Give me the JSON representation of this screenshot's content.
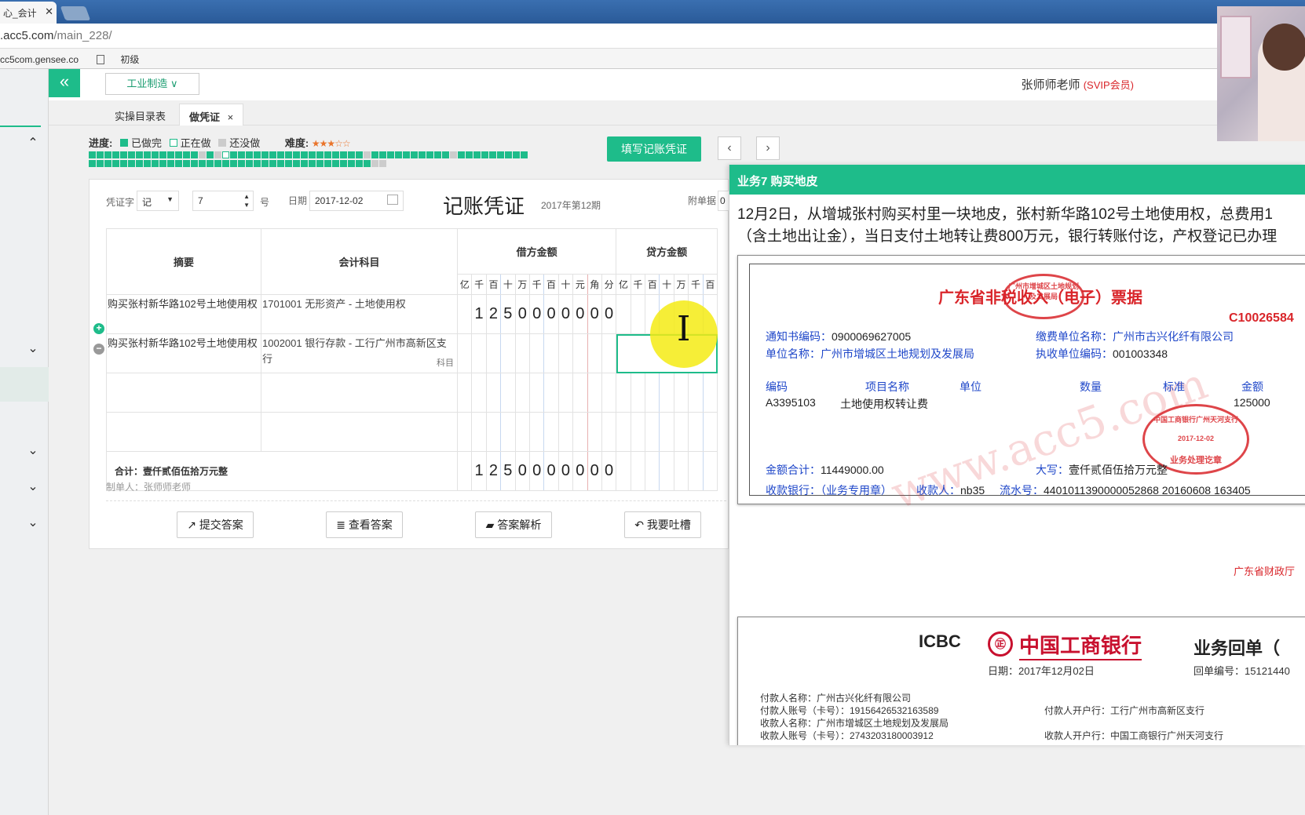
{
  "browser": {
    "tab_title": "心_会计",
    "url_host": ".acc5.com",
    "url_path": "/main_228/",
    "bookmarks": [
      "cc5com.gensee.co",
      "初级"
    ]
  },
  "header": {
    "industry": "工业制造 ∨",
    "user_name": "张师师老师",
    "user_vip": "(SVIP会员)"
  },
  "subtabs": [
    "实操目录表",
    "做凭证"
  ],
  "progress": {
    "label": "进度:",
    "done": "已做完",
    "doing": "正在做",
    "todo": "还没做",
    "difficulty_label": "难度:",
    "difficulty_stars": "★★★☆☆"
  },
  "actions": {
    "fill_voucher": "填写记账凭证",
    "prev": "‹",
    "next": "›"
  },
  "voucher": {
    "word_label": "凭证字",
    "word_value": "记",
    "number": "7",
    "number_suffix": "号",
    "date_label": "日期",
    "date_value": "2017-12-02",
    "title": "记账凭证",
    "period": "2017年第12期",
    "attach_label": "附单据",
    "attach_value": "0",
    "headers": {
      "summary": "摘要",
      "account": "会计科目",
      "debit": "借方金额",
      "credit": "贷方金额"
    },
    "digit_units": [
      "亿",
      "千",
      "百",
      "十",
      "万",
      "千",
      "百",
      "十",
      "元",
      "角",
      "分"
    ],
    "rows": [
      {
        "summary": "购买张村新华路102号土地使用权",
        "account": "1701001 无形资产 - 土地使用权",
        "debit_digits": [
          "",
          "1",
          "2",
          "5",
          "0",
          "0",
          "0",
          "0",
          "0",
          "0",
          "0"
        ]
      },
      {
        "summary": "购买张村新华路102号土地使用权",
        "account": "1002001 银行存款 - 工行广州市高新区支行",
        "account_tag": "科目",
        "debit_digits": [
          "",
          "",
          "",
          "",
          "",
          "",
          "",
          "",
          "",
          "",
          ""
        ]
      }
    ],
    "total_label": "合计：壹仟贰佰伍拾万元整",
    "total_digits": [
      "",
      "1",
      "2",
      "5",
      "0",
      "0",
      "0",
      "0",
      "0",
      "0",
      "0"
    ],
    "maker": "制单人：张师师老师",
    "buttons": {
      "submit": "提交答案",
      "view": "查看答案",
      "analysis": "答案解析",
      "complain": "我要吐槽"
    }
  },
  "panel": {
    "title": "业务7 购买地皮",
    "desc_line1": "12月2日，从增城张村购买村里一块地皮，张村新华路102号土地使用权，总费用1",
    "desc_line2": "（含土地出让金），当日支付土地转让费800万元，银行转账付讫，产权登记已办理",
    "receipt1": {
      "title": "广东省非税收入（电子）票据",
      "code": "C10026584",
      "notice_label": "通知书编码：",
      "notice_value": "0900069627005",
      "payer_label": "缴费单位名称：",
      "payer_value": "广州市古兴化纤有限公司",
      "unit_label": "单位名称：",
      "unit_value": "广州市增城区土地规划及发展局",
      "exec_label": "执收单位编码：",
      "exec_value": "001003348",
      "col_code": "编码",
      "col_item": "项目名称",
      "col_unit": "单位",
      "col_qty": "数量",
      "col_std": "标准",
      "col_amt": "金额",
      "item_code": "A3395103",
      "item_name": "土地使用权转让费",
      "item_amt": "125000",
      "sum_label": "金额合计：",
      "sum_value": "11449000.00",
      "cap_label": "大写：",
      "cap_value": "壹仟贰佰伍拾万元整",
      "bank_label": "收款银行：（业务专用章）",
      "payee_label": "收款人：",
      "payee_value": "nb35",
      "serial_label": "流水号：",
      "serial_value": "4401011390000052868 20160608 163405",
      "footer": "广东省财政厅",
      "watermark": "www.acc5.com",
      "seal1_text": "广州市增城区土地规划及发展局",
      "seal2_text": "中国工商银行广州天河支行",
      "seal2_date": "2017-12-02",
      "seal2_bottom": "业务处理讫章"
    },
    "receipt2": {
      "icbc": "ICBC",
      "icbc_symbol": "㊣",
      "bank_name": "中国工商银行",
      "title": "业务回单（",
      "date": "日期：2017年12月02日",
      "receipt_no": "回单编号：15121440",
      "payer_name": "付款人名称：广州古兴化纤有限公司",
      "payer_acct": "付款人账号（卡号）：19156426532163589",
      "payee_name": "收款人名称：广州市增城区土地规划及发展局",
      "payee_acct": "收款人账号（卡号）：2743203180003912",
      "payer_bank": "付款人开户行：工行广州市高新区支行",
      "payee_bank": "收款人开户行：中国工商银行广州天河支行"
    }
  }
}
